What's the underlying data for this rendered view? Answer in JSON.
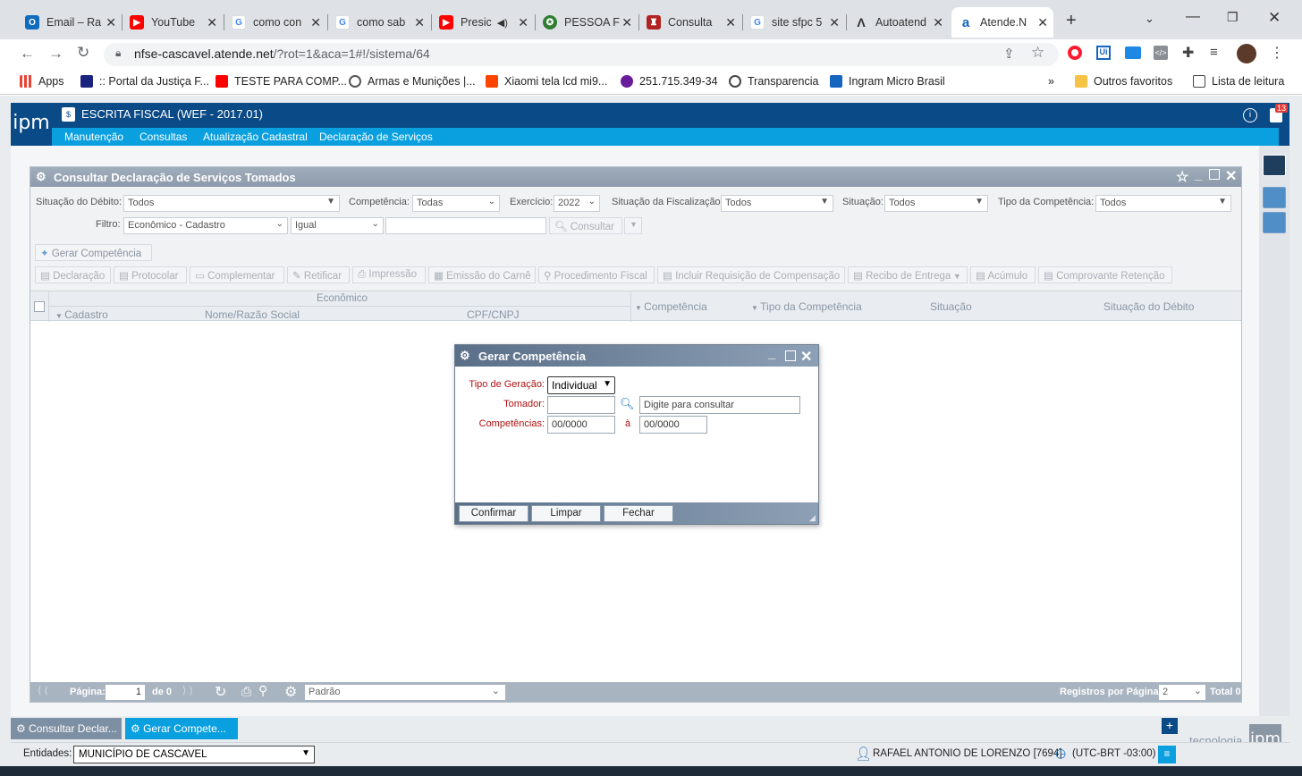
{
  "browser": {
    "tabs": [
      {
        "label": "Email – Ra",
        "icon": "outlook-icon",
        "color": "#0f6cbd"
      },
      {
        "label": "YouTube",
        "icon": "youtube-icon",
        "color": "#ff0000"
      },
      {
        "label": "como con",
        "icon": "google-icon",
        "color": "#4285f4"
      },
      {
        "label": "como sab",
        "icon": "google-icon",
        "color": "#4285f4"
      },
      {
        "label": "Presic",
        "icon": "youtube-icon",
        "color": "#ff0000"
      },
      {
        "label": "PESSOA F",
        "icon": "gov-seal-icon",
        "color": "#2f7d32"
      },
      {
        "label": "Consulta",
        "icon": "shield-icon",
        "color": "#b22222"
      },
      {
        "label": "site sfpc 5",
        "icon": "google-icon",
        "color": "#4285f4"
      },
      {
        "label": "Autoatend",
        "icon": "lambda-icon",
        "color": "#333333"
      },
      {
        "label": "Atende.N",
        "icon": "atende-icon",
        "color": "#1565c0"
      }
    ],
    "url_host": "nfse-cascavel.atende.net",
    "url_path": "/?rot=1&aca=1#!/sistema/64",
    "bookmarks": [
      {
        "label": "Apps"
      },
      {
        "label": ":: Portal da Justiça F..."
      },
      {
        "label": "TESTE PARA COMP..."
      },
      {
        "label": "Armas e Munições |..."
      },
      {
        "label": "Xiaomi tela lcd mi9..."
      },
      {
        "label": "251.715.349-34"
      },
      {
        "label": "Transparencia"
      },
      {
        "label": "Ingram Micro Brasil"
      }
    ],
    "more_bookmarks": "»",
    "other_favorites": "Outros favoritos",
    "reading_list": "Lista de leitura"
  },
  "app": {
    "logo": "ipm",
    "title": "ESCRITA FISCAL (WEF - 2017.01)",
    "notification_count": "13",
    "menu": [
      "Manutenção",
      "Consultas",
      "Atualização Cadastral",
      "Declaração de Serviços"
    ]
  },
  "window": {
    "title": "Consultar Declaração de Serviços Tomados",
    "filters": {
      "situacao_debito_label": "Situação do Débito:",
      "situacao_debito_value": "Todos",
      "competencia_label": "Competência:",
      "competencia_value": "Todas",
      "exercicio_label": "Exercício:",
      "exercicio_value": "2022",
      "situacao_fiscalizacao_label": "Situação da Fiscalização:",
      "situacao_fiscalizacao_value": "Todos",
      "situacao_label": "Situação:",
      "situacao_value": "Todos",
      "tipo_competencia_label": "Tipo da Competência:",
      "tipo_competencia_value": "Todos",
      "filtro_label": "Filtro:",
      "filtro_value": "Econômico - Cadastro",
      "operator_value": "Igual",
      "consultar_label": "Consultar"
    },
    "gerar_competencia_label": "Gerar Competência",
    "toolbar": [
      "Declaração",
      "Protocolar",
      "Complementar",
      "Retificar",
      "Impressão",
      "Emissão do Carnê",
      "Procedimento Fiscal",
      "Incluir Requisição de Compensação",
      "Recibo de Entrega",
      "Acúmulo",
      "Comprovante Retenção"
    ],
    "grid": {
      "group_header": "Econômico",
      "columns": [
        "Cadastro",
        "Nome/Razão Social",
        "CPF/CNPJ",
        "Competência",
        "Tipo da Competência",
        "Situação",
        "Situação do Débito"
      ]
    },
    "pager": {
      "page_label": "Página:",
      "page_value": "1",
      "of_label": "de 0",
      "layout_value": "Padrão",
      "per_page_label": "Registros por Página:",
      "per_page_value": "2",
      "total_label": "Total 0"
    }
  },
  "dialog": {
    "title": "Gerar Competência",
    "tipo_geracao_label": "Tipo de Geração:",
    "tipo_geracao_value": "Individual",
    "tomador_label": "Tomador:",
    "tomador_code": "",
    "tomador_placeholder": "Digite para consultar",
    "competencias_label": "Competências:",
    "competencia_from": "00/0000",
    "competencia_sep": "à",
    "competencia_to": "00/0000",
    "buttons": {
      "confirm": "Confirmar",
      "clear": "Limpar",
      "close": "Fechar"
    }
  },
  "taskbar": {
    "tasks": [
      "Consultar Declar...",
      "Gerar Compete..."
    ],
    "brand": "tecnologia",
    "brand_logo": "ipm"
  },
  "statusbar": {
    "entidades_label": "Entidades:",
    "entidades_value": "MUNICÍPIO DE CASCAVEL",
    "user": "RAFAEL ANTONIO DE LORENZO [7694]",
    "timezone": "(UTC-BRT -03:00)"
  }
}
